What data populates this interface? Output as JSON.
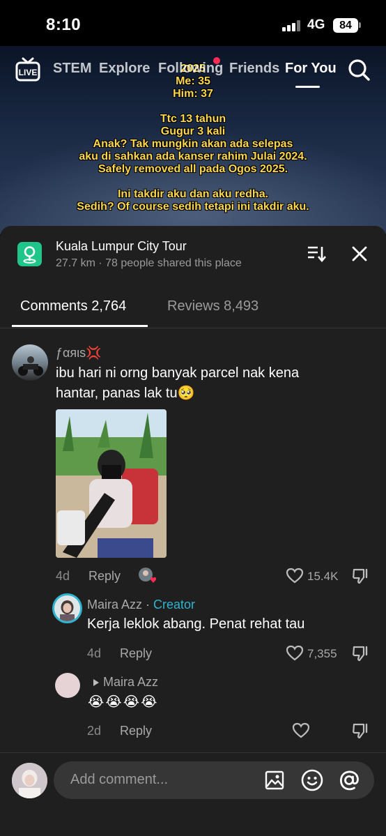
{
  "status_bar": {
    "time": "8:10",
    "network": "4G",
    "battery": "84"
  },
  "video_overlay": {
    "lines": [
      "2025",
      "Me: 35",
      "Him: 37",
      "",
      "Ttc 13 tahun",
      "Gugur 3 kali",
      "Anak? Tak mungkin akan ada selepas",
      "aku di sahkan ada kanser rahim Julai 2024.",
      "Safely removed all pada Ogos 2025.",
      "",
      "Ini takdir aku dan aku redha.",
      "Sedih? Of course sedih tetapi ini takdir aku."
    ]
  },
  "top_nav": {
    "live_label": "LIVE",
    "tabs": [
      "STEM",
      "Explore",
      "Following",
      "Friends",
      "For You"
    ],
    "active_tab": "For You"
  },
  "place": {
    "title": "Kuala Lumpur City Tour",
    "subtitle": "27.7 km · 78 people shared this place"
  },
  "tabs": {
    "comments": "Comments 2,764",
    "reviews": "Reviews 8,493"
  },
  "comments": [
    {
      "username": "ƒαяιѕ💢",
      "text_line1": "ibu hari ni orng banyak parcel nak kena",
      "text_line2": "hantar, panas lak tu🥺",
      "age": "4d",
      "reply": "Reply",
      "likes": "15.4K"
    },
    {
      "username": "Maira Azz",
      "creator_label": "Creator",
      "separator": " · ",
      "text": "Kerja leklok abang. Penat rehat tau",
      "age": "4d",
      "reply": "Reply",
      "likes": "7,355"
    },
    {
      "reply_to": "Maira Azz",
      "text": "😭😭😭😭",
      "age": "2d",
      "reply": "Reply"
    }
  ],
  "input": {
    "placeholder": "Add comment..."
  },
  "colors": {
    "accent_red": "#fe2c55",
    "creator_teal": "#2fb5d0",
    "place_green": "#20c58a",
    "overlay_yellow": "#ffd84a"
  }
}
